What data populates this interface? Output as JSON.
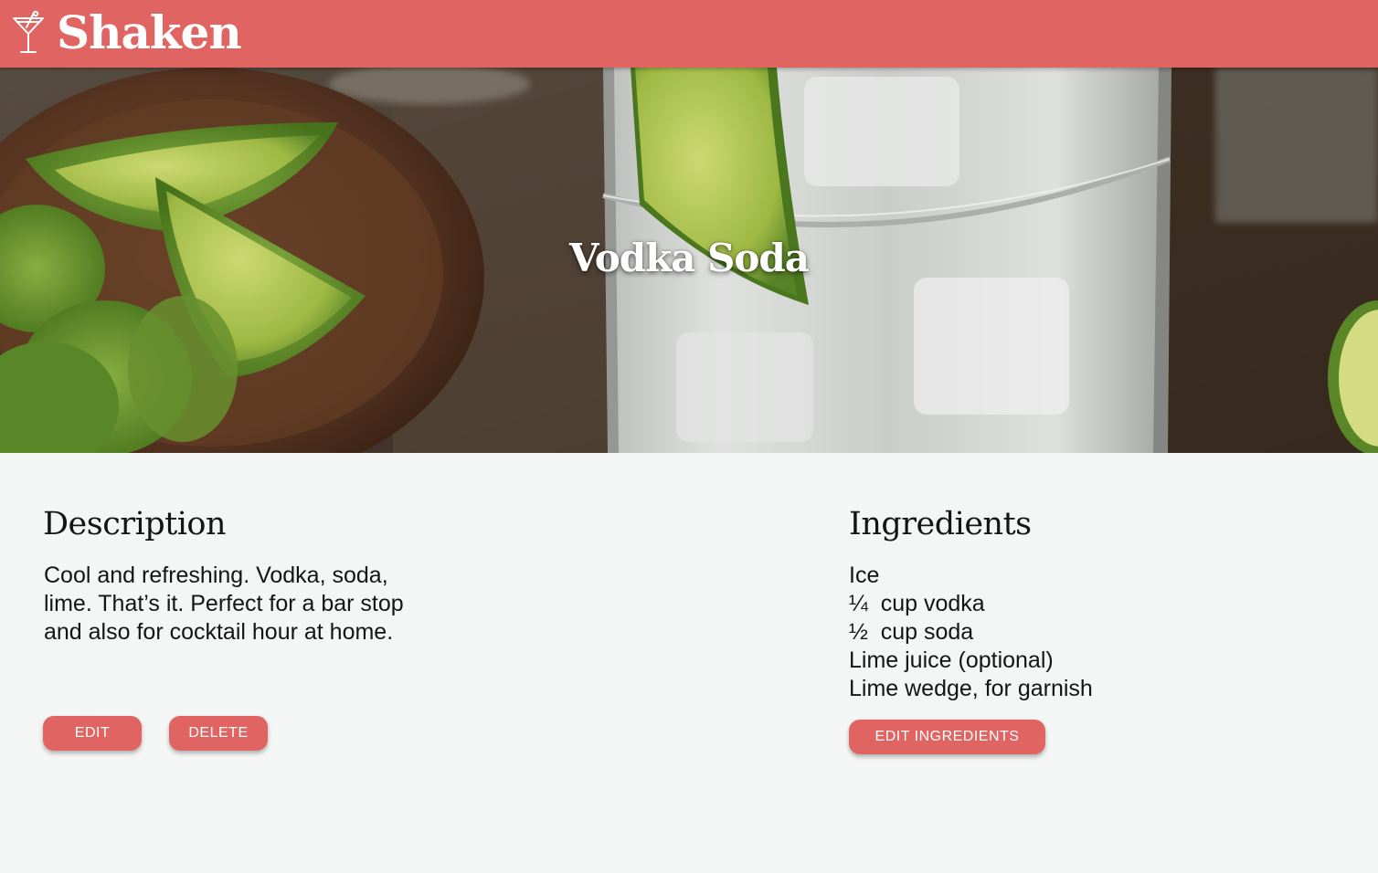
{
  "header": {
    "brand": "Shaken",
    "logo_icon": "martini-glass-icon",
    "color": "#e06462"
  },
  "hero": {
    "title": "Vodka Soda",
    "image_subject": "cocktail-photo"
  },
  "description": {
    "heading": "Description",
    "text": "Cool and refreshing. Vodka, soda, lime. That’s it. Perfect for a bar stop and also for cocktail hour at home.",
    "edit_label": "EDIT",
    "delete_label": "DELETE"
  },
  "ingredients": {
    "heading": "Ingredients",
    "items": [
      "Ice",
      "¼  cup vodka",
      "½  cup soda",
      "Lime juice (optional)",
      "Lime wedge, for garnish"
    ],
    "edit_label": "EDIT INGREDIENTS"
  },
  "colors": {
    "accent": "#e06462",
    "background": "#f4f6f5",
    "text": "#151515"
  }
}
